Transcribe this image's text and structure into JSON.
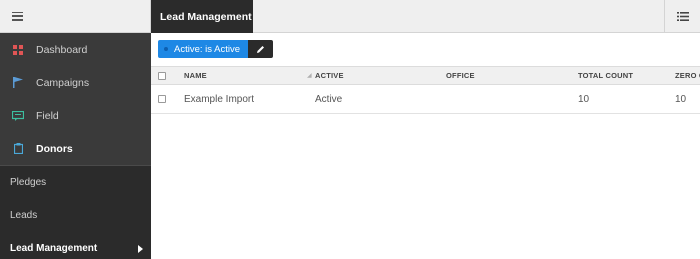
{
  "sidebar": {
    "primary_items": [
      {
        "label": "Dashboard",
        "icon": "dashboard-icon",
        "icon_color": "#e05555"
      },
      {
        "label": "Campaigns",
        "icon": "flag-icon",
        "icon_color": "#5b9bd5"
      },
      {
        "label": "Field",
        "icon": "message-icon",
        "icon_color": "#3cbfa0"
      },
      {
        "label": "Donors",
        "icon": "clipboard-icon",
        "icon_color": "#4aa8d8"
      }
    ],
    "sub_items": [
      {
        "label": "Pledges"
      },
      {
        "label": "Leads"
      },
      {
        "label": "Lead Management"
      }
    ]
  },
  "header": {
    "title": "Lead Management"
  },
  "filter": {
    "chip_label": "Active: is Active",
    "accent": "#1e88e5"
  },
  "table": {
    "columns": [
      "NAME",
      "ACTIVE",
      "OFFICE",
      "TOTAL COUNT",
      "ZERO C"
    ],
    "rows": [
      {
        "name": "Example Import",
        "active": "Active",
        "office": "",
        "total_count": "10",
        "zero": "10"
      }
    ]
  }
}
